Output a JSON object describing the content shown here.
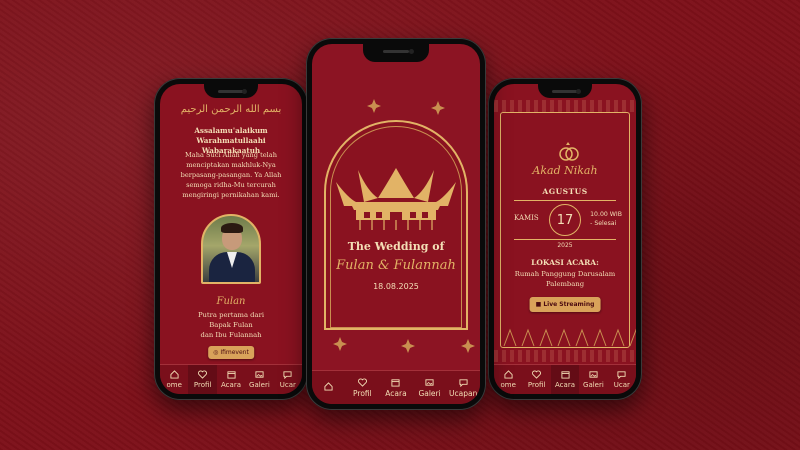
{
  "colors": {
    "background": "#7d1019",
    "accent_gold": "#e2b366",
    "cream": "#f4dfb6",
    "button": "#d9a25a"
  },
  "phone_left": {
    "arabic_header": "بسم الله الرحمن الرحيم",
    "greeting": "Assalamu'alaikum Warahmatullaahi Wabarakaatuh",
    "intro": "Maha Suci Allah yang telah menciptakan makhluk-Nya berpasang-pasangan. Ya Allah semoga ridha-Mu tercurah mengiringi pernikahan kami.",
    "groom_name": "Fulan",
    "groom_desc_1": "Putra pertama dari",
    "groom_desc_2": "Bapak Fulan",
    "groom_desc_3": "dan Ibu Fulannah",
    "instagram_label": "Ifimevent",
    "nav": [
      {
        "label": "ome",
        "icon": "home-icon"
      },
      {
        "label": "Profil",
        "icon": "heart-icon"
      },
      {
        "label": "Acara",
        "icon": "calendar-icon"
      },
      {
        "label": "Galeri",
        "icon": "image-icon"
      },
      {
        "label": "Ucar",
        "icon": "chat-icon"
      }
    ]
  },
  "phone_center": {
    "wedding_title": "The Wedding of",
    "couple": "Fulan & Fulannah",
    "date": "18.08.2025",
    "nav": [
      {
        "label": "",
        "icon": "home-icon"
      },
      {
        "label": "Profil",
        "icon": "heart-icon"
      },
      {
        "label": "Acara",
        "icon": "calendar-icon"
      },
      {
        "label": "Galeri",
        "icon": "image-icon"
      },
      {
        "label": "Ucapan",
        "icon": "chat-icon"
      }
    ]
  },
  "phone_right": {
    "event_title": "Akad Nikah",
    "month": "AGUSTUS",
    "day": "KAMIS",
    "date_num": "17",
    "time_1": "10.00 WIB",
    "time_2": "- Selesai",
    "year": "2025",
    "location_title": "LOKASI ACARA:",
    "location_1": "Rumah Panggung Darusalam",
    "location_2": "Palembang",
    "live_label": "Live Streaming",
    "nav": [
      {
        "label": "ome",
        "icon": "home-icon"
      },
      {
        "label": "Profil",
        "icon": "heart-icon"
      },
      {
        "label": "Acara",
        "icon": "calendar-icon"
      },
      {
        "label": "Galeri",
        "icon": "image-icon"
      },
      {
        "label": "Ucar",
        "icon": "chat-icon"
      }
    ]
  }
}
